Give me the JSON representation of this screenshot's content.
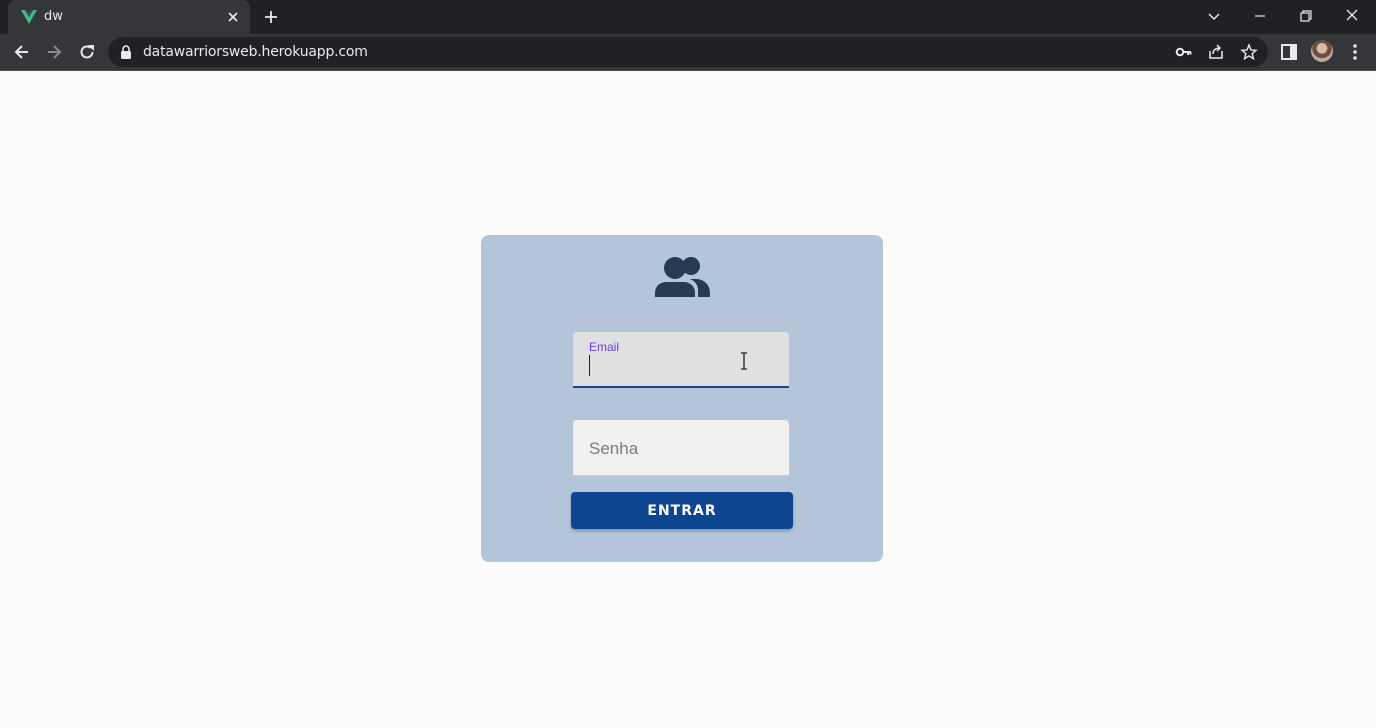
{
  "browser": {
    "tab": {
      "title": "dw",
      "favicon": "vue-logo-icon"
    },
    "address": {
      "url": "datawarriorsweb.herokuapp.com"
    },
    "colors": {
      "frame": "#202124",
      "toolbar": "#35363a",
      "favicon": "#41b883"
    }
  },
  "login": {
    "icon": "users-icon",
    "email": {
      "label": "Email",
      "value": ""
    },
    "password": {
      "placeholder": "Senha"
    },
    "submit_label": "ENTRAR",
    "colors": {
      "card": "#b4c5d9",
      "button": "#0d4590",
      "label": "#6f3ed6",
      "email_underline": "#1f3f8a",
      "icon": "#263a52"
    }
  }
}
